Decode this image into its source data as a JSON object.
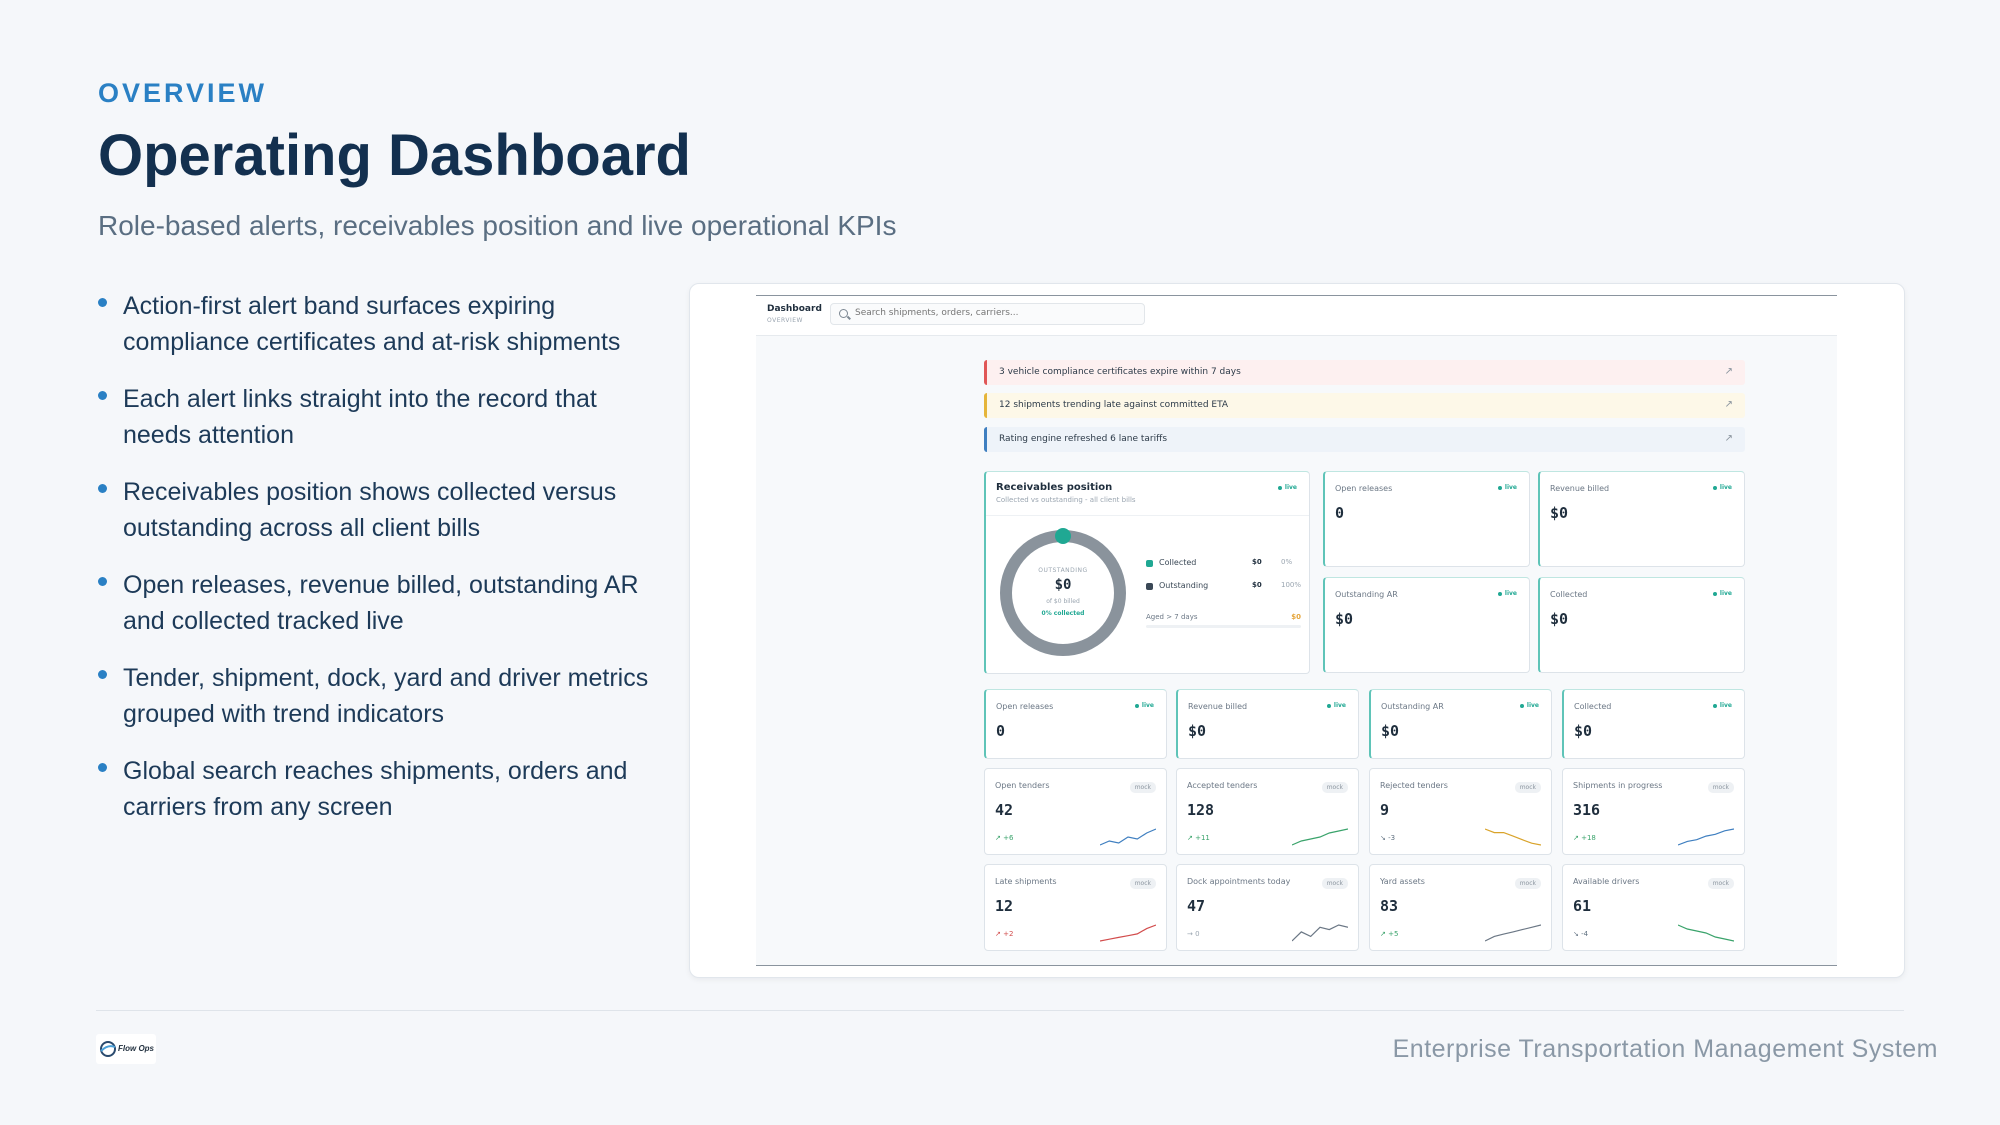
{
  "slide": {
    "eyebrow": "OVERVIEW",
    "title": "Operating Dashboard",
    "subtitle": "Role-based alerts, receivables position and live operational KPIs",
    "bullets": [
      "Action-first alert band surfaces expiring compliance certificates and at-risk shipments",
      "Each alert links straight into the record that needs attention",
      "Receivables position shows collected versus outstanding across all client bills",
      "Open releases, revenue billed, outstanding AR and collected tracked live",
      "Tender, shipment, dock, yard and driver metrics grouped with trend indicators",
      "Global search reaches shipments, orders and carriers from any screen"
    ],
    "footer_text": "Enterprise Transportation Management System",
    "logo_text": "Flow Ops"
  },
  "app": {
    "brand": "Dashboard",
    "brand_sub": "OVERVIEW",
    "search_placeholder": "Search shipments, orders, carriers...",
    "alerts": [
      {
        "text": "3 vehicle compliance certificates expire within 7 days",
        "arrow": "↗"
      },
      {
        "text": "12 shipments trending late against committed ETA",
        "arrow": "↗"
      },
      {
        "text": "Rating engine refreshed 6 lane tariffs",
        "arrow": "↗"
      }
    ],
    "receivables": {
      "title": "Receivables position",
      "subtitle": "Collected vs outstanding - all client bills",
      "badge": "live",
      "center_label": "OUTSTANDING",
      "center_value": "$0",
      "center_sub": "of $0 billed",
      "center_pct": "0% collected",
      "collected_fraction": 0.0,
      "legend": [
        {
          "label": "Collected",
          "amount": "$0",
          "pct": "0%",
          "color": "#20a893"
        },
        {
          "label": "Outstanding",
          "amount": "$0",
          "pct": "100%",
          "color": "#3a4856"
        }
      ],
      "aged_label": "Aged > 7 days",
      "aged_amount": "$0"
    },
    "kpi_top": [
      {
        "label": "Open releases",
        "value": "0",
        "badge": "live"
      },
      {
        "label": "Revenue billed",
        "value": "$0",
        "badge": "live"
      },
      {
        "label": "Outstanding AR",
        "value": "$0",
        "badge": "live"
      },
      {
        "label": "Collected",
        "value": "$0",
        "badge": "live"
      }
    ],
    "kpi_row": [
      {
        "label": "Open releases",
        "value": "0",
        "badge": "live"
      },
      {
        "label": "Revenue billed",
        "value": "$0",
        "badge": "live"
      },
      {
        "label": "Outstanding AR",
        "value": "$0",
        "badge": "live"
      },
      {
        "label": "Collected",
        "value": "$0",
        "badge": "live"
      }
    ],
    "metrics": [
      {
        "label": "Open tenders",
        "value": "42",
        "badge": "mock",
        "trend": "↗ +6",
        "color": "#3f7fc0",
        "spark": [
          3,
          4,
          3.5,
          5,
          4.5,
          6,
          7
        ]
      },
      {
        "label": "Accepted tenders",
        "value": "128",
        "badge": "mock",
        "trend": "↗ +11",
        "color": "#3aa36b",
        "spark": [
          2,
          3,
          3.5,
          4,
          5,
          5.5,
          6
        ]
      },
      {
        "label": "Rejected tenders",
        "value": "9",
        "badge": "mock",
        "trend": "↘ -3",
        "color": "#d9a32a",
        "spark": [
          7,
          6,
          6,
          5,
          4,
          3,
          2.5
        ]
      },
      {
        "label": "Shipments in progress",
        "value": "316",
        "badge": "mock",
        "trend": "↗ +18",
        "color": "#3f7fc0",
        "spark": [
          2,
          3,
          3.5,
          4.5,
          5,
          6,
          6.5
        ]
      },
      {
        "label": "Late shipments",
        "value": "12",
        "badge": "mock",
        "trend": "↗ +2",
        "color": "#d24c4c",
        "spark": [
          2,
          2.5,
          3,
          3.5,
          4,
          5.5,
          6.5
        ]
      },
      {
        "label": "Dock appointments today",
        "value": "47",
        "badge": "mock",
        "trend": "→ 0",
        "color": "#6b7785",
        "spark": [
          3,
          5,
          4,
          6,
          5.5,
          6.5,
          6
        ]
      },
      {
        "label": "Yard assets",
        "value": "83",
        "badge": "mock",
        "trend": "↗ +5",
        "color": "#6b7785",
        "spark": [
          2,
          3,
          3.5,
          4,
          4.5,
          5,
          5.5
        ]
      },
      {
        "label": "Available drivers",
        "value": "61",
        "badge": "mock",
        "trend": "↘ -4",
        "color": "#3aa36b",
        "spark": [
          7,
          6,
          5.5,
          5,
          4,
          3.5,
          3
        ]
      }
    ]
  }
}
